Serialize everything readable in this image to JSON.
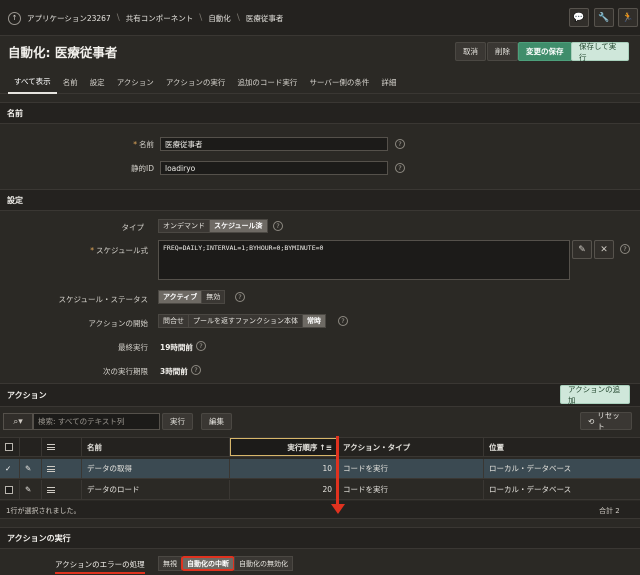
{
  "breadcrumb": {
    "home_icon": "up-arrow-icon",
    "items": [
      "アプリケーション23267",
      "共有コンポーネント",
      "自動化",
      "医療従事者"
    ]
  },
  "toolbar_icons": [
    "chat-icon",
    "wrench-icon",
    "person-run-icon"
  ],
  "page": {
    "title": "自動化: 医療従事者",
    "buttons": {
      "cancel": "取消",
      "delete": "削除",
      "save": "変更の保存",
      "save_run": "保存して実行"
    }
  },
  "tabs": [
    "すべて表示",
    "名前",
    "設定",
    "アクション",
    "アクションの実行",
    "追加のコード実行",
    "サーバー側の条件",
    "詳細"
  ],
  "sections": {
    "name": {
      "header": "名前",
      "name_label": "名前",
      "name_value": "医療従事者",
      "static_id_label": "静的ID",
      "static_id_value": "loadiryo"
    },
    "settings": {
      "header": "設定",
      "type_label": "タイプ",
      "type_options": [
        "オンデマンド",
        "スケジュール済"
      ],
      "type_selected": "スケジュール済",
      "schedule_label": "スケジュール式",
      "schedule_value": "FREQ=DAILY;INTERVAL=1;BYHOUR=0;BYMINUTE=0",
      "status_label": "スケジュール・ステータス",
      "status_options": [
        "アクティブ",
        "無効"
      ],
      "status_selected": "アクティブ",
      "start_label": "アクションの開始",
      "start_options": [
        "問合せ",
        "プールを返すファンクション本体",
        "常時"
      ],
      "start_selected": "常時",
      "last_run_label": "最終実行",
      "last_run_value": "19時間前",
      "next_run_label": "次の実行期限",
      "next_run_value": "3時間前"
    },
    "actions": {
      "header": "アクション",
      "add_button": "アクションの追加",
      "search_placeholder": "検索: すべてのテキスト列",
      "go_button": "実行",
      "edit_button": "編集",
      "reset_button": "リセット",
      "columns": [
        "名前",
        "実行順序",
        "アクション・タイプ",
        "位置"
      ],
      "rows": [
        {
          "name": "データの取得",
          "order": "10",
          "type": "コードを実行",
          "location": "ローカル・データベース"
        },
        {
          "name": "データのロード",
          "order": "20",
          "type": "コードを実行",
          "location": "ローカル・データベース"
        }
      ],
      "footer_selected": "1行が選択されました。",
      "footer_total": "合計 2"
    },
    "execution": {
      "header": "アクションの実行",
      "error_label": "アクションのエラーの処理",
      "options": [
        "無視",
        "自動化の中断",
        "自動化の無効化"
      ],
      "selected": "自動化の中断"
    }
  },
  "colors": {
    "accent_green": "#3f8d6b",
    "annotation_red": "#e0321f"
  }
}
